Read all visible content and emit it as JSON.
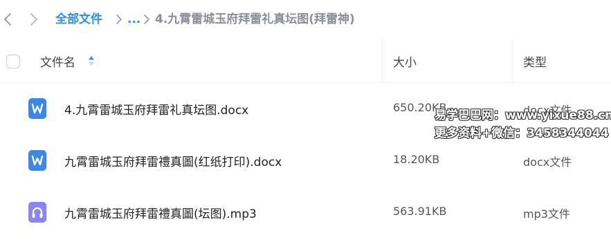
{
  "breadcrumb": {
    "root": "全部文件",
    "ellipsis": "...",
    "current": "4.九霄雷城玉府拜雷礼真坛图(拜雷神)"
  },
  "columns": {
    "name": "文件名",
    "size": "大小",
    "type": "类型"
  },
  "files": [
    {
      "name": "4.九霄雷城玉府拜雷礼真坛图.docx",
      "size": "650.20KB",
      "type": "docx文件",
      "icon": "word-doc-icon"
    },
    {
      "name": "九霄雷城玉府拜雷禮真圖(红纸打印).docx",
      "size": "18.20KB",
      "type": "docx文件",
      "icon": "word-doc-icon"
    },
    {
      "name": "九霄雷城玉府拜雷禮真圖(坛图).mp3",
      "size": "563.91KB",
      "type": "mp3文件",
      "icon": "audio-file-icon"
    }
  ],
  "watermark": {
    "line1": "易学巴巴网：www.yixue88.cn",
    "line2": "更多资料+微信：3458344044"
  },
  "colors": {
    "accent": "#2f8eea",
    "word_icon": "#3c88e8",
    "audio_icon": "#8a85f5"
  }
}
